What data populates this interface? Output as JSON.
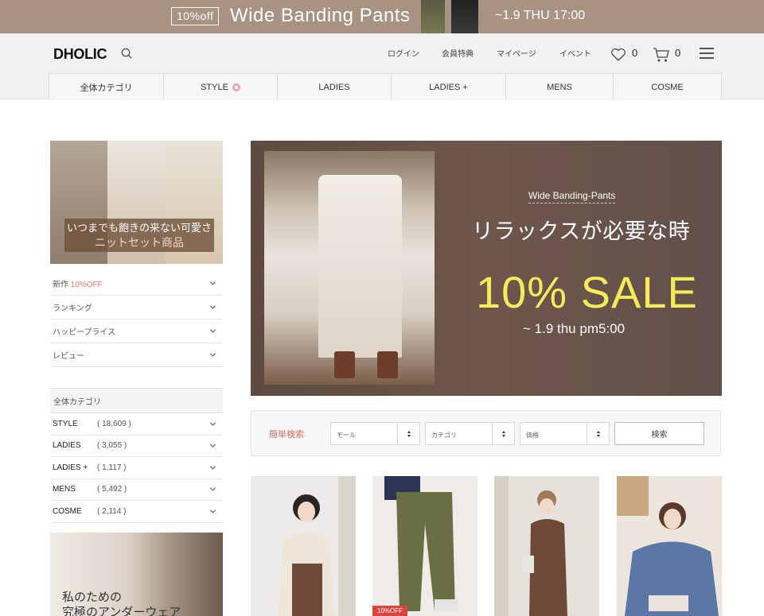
{
  "promo": {
    "badge": "10%off",
    "title": "Wide Banding Pants",
    "date": "~1.9 THU 17:00"
  },
  "header": {
    "logo": "DHOLIC",
    "nav": [
      "ログイン",
      "会員特典",
      "マイページ",
      "イベント"
    ],
    "wishlist_count": "0",
    "cart_count": "0"
  },
  "categories": [
    "全体カテゴリ",
    "STYLE",
    "LADIES",
    "LADIES +",
    "MENS",
    "COSME"
  ],
  "side_banner": {
    "line1": "いつまでも飽きの来ない可愛さ",
    "line2": "ニットセット商品"
  },
  "side_menu": [
    {
      "label": "新作 ",
      "highlight": "10%OFF"
    },
    {
      "label": "ランキング",
      "highlight": ""
    },
    {
      "label": "ハッピープライス",
      "highlight": ""
    },
    {
      "label": "レビュー",
      "highlight": ""
    }
  ],
  "category_panel": {
    "title": "全体カテゴリ",
    "items": [
      {
        "name": "STYLE",
        "count": "( 18,609 )"
      },
      {
        "name": "LADIES",
        "count": "( 3,055 )"
      },
      {
        "name": "LADIES +",
        "count": "( 1,117 )"
      },
      {
        "name": "MENS",
        "count": "( 5,492 )"
      },
      {
        "name": "COSME",
        "count": "( 2,114 )"
      }
    ]
  },
  "side_banner2": {
    "line1": "私のための",
    "line2": "究極のアンダーウェア"
  },
  "hero": {
    "subtitle": "Wide Banding-Pants",
    "headline": "リラックスが必要な時",
    "sale": "10% SALE",
    "until": "~ 1.9 thu pm5:00"
  },
  "filter": {
    "label": "簡単検索",
    "mall": "モール",
    "category": "カテゴリ",
    "price": "価格",
    "button": "検索"
  },
  "products": [
    {
      "tag": ""
    },
    {
      "tag": "10%OFF"
    },
    {
      "tag": ""
    },
    {
      "tag": ""
    }
  ],
  "colors": {
    "promo_bg": "#a89282",
    "accent_red": "#e07a6d",
    "sale_yellow": "#f3ec58"
  }
}
